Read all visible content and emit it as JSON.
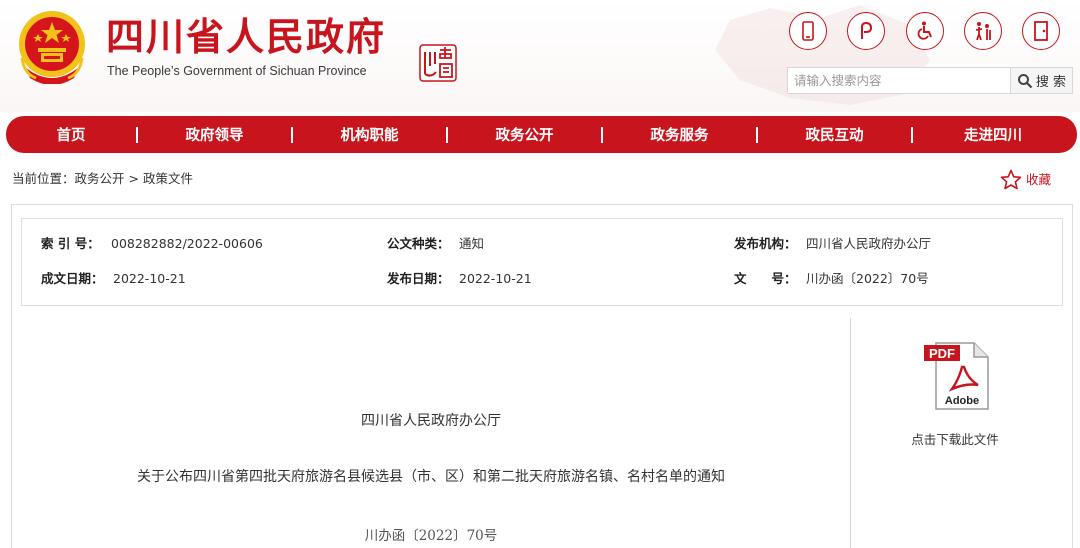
{
  "header": {
    "title": "四川省人民政府",
    "subtitle": "The People’s Government of Sichuan Province",
    "seal_text": "中國四川",
    "top_icons": [
      "mobile-icon",
      "weibo-icon",
      "accessibility-icon",
      "elderly-care-icon",
      "exit-icon"
    ]
  },
  "search": {
    "placeholder": "请输入搜索内容",
    "button_label": "搜 索"
  },
  "nav": {
    "items": [
      "首页",
      "政府领导",
      "机构职能",
      "政务公开",
      "政务服务",
      "政民互动",
      "走进四川"
    ]
  },
  "breadcrumb": {
    "prefix": "当前位置：",
    "items": [
      "政务公开",
      "政策文件"
    ],
    "separator": ">"
  },
  "favorite": {
    "label": "收藏"
  },
  "meta": {
    "index_label": "索 引 号：",
    "index_value": "008282882/2022-00606",
    "doc_type_label": "公文种类：",
    "doc_type_value": "通知",
    "publisher_label": "发布机构：",
    "publisher_value": "四川省人民政府办公厅",
    "written_date_label": "成文日期：",
    "written_date_value": "2022-10-21",
    "publish_date_label": "发布日期：",
    "publish_date_value": "2022-10-21",
    "doc_no_label": "文　　号：",
    "doc_no_value": "川办函〔2022〕70号"
  },
  "document": {
    "issuer": "四川省人民政府办公厅",
    "title": "关于公布四川省第四批天府旅游名县候选县（市、区）和第二批天府旅游名镇、名村名单的通知",
    "number": "川办函〔2022〕70号"
  },
  "download": {
    "pdf_badge": "PDF",
    "brand": "Adobe",
    "label": "点击下载此文件"
  },
  "colors": {
    "brand_red": "#c8151d",
    "emblem_gold": "#f2c21a"
  }
}
